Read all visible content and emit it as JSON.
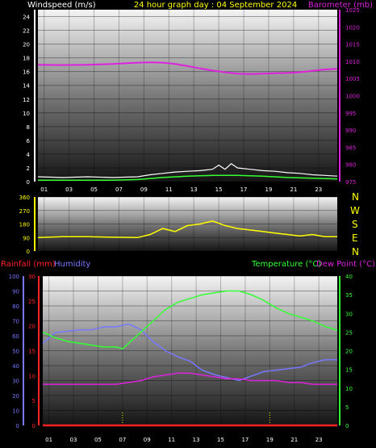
{
  "header": {
    "windspeed_label": "Windspeed (m/s)",
    "title": "24 hour graph day : 04 September 2024",
    "barometer_label": "Barometer (mb)"
  },
  "lower_header": {
    "rainfall_label": "Rainfall (mm)",
    "humidity_label": "Humidity",
    "temperature_label": "Temperature (°C)",
    "dewpoint_label": "Dew Point (°C)"
  },
  "compass": [
    "N",
    "W",
    "S",
    "E",
    "N"
  ],
  "colors": {
    "windspeed": "#ffffff",
    "gust": "#ffffff",
    "wind_avg": "#33ff33",
    "barometer": "#dd22dd",
    "direction": "#ffff00",
    "rainfall": "#ff2222",
    "humidity": "#7777ff",
    "temperature": "#33ff33",
    "dewpoint": "#dd22dd",
    "title": "#ffff00"
  },
  "chart_data": [
    {
      "type": "line",
      "panel": "wind-barometer",
      "x_ticks": [
        "01",
        "03",
        "05",
        "07",
        "09",
        "11",
        "13",
        "15",
        "17",
        "19",
        "21",
        "23"
      ],
      "y_left_ticks": [
        "0",
        "2",
        "4",
        "6",
        "8",
        "10",
        "12",
        "14",
        "16",
        "18",
        "20",
        "22",
        "24"
      ],
      "y_right_ticks": [
        "975",
        "980",
        "985",
        "990",
        "995",
        "1000",
        "1005",
        "1010",
        "1015",
        "1020",
        "1025"
      ],
      "y_left_range": [
        0,
        25
      ],
      "y_right_range": [
        975,
        1025
      ],
      "series": [
        {
          "name": "Windspeed (m/s)",
          "axis": "left",
          "x": [
            0,
            2,
            4,
            6,
            8,
            9,
            10,
            11,
            12,
            13,
            14,
            14.5,
            15,
            15.5,
            16,
            17,
            18,
            19,
            20,
            21,
            22,
            23,
            24
          ],
          "values": [
            0.7,
            0.6,
            0.7,
            0.6,
            0.7,
            1.0,
            1.2,
            1.4,
            1.5,
            1.6,
            1.8,
            2.4,
            1.8,
            2.6,
            2.0,
            1.8,
            1.6,
            1.5,
            1.3,
            1.2,
            1.0,
            0.9,
            0.8
          ]
        },
        {
          "name": "Wind average",
          "axis": "left",
          "x": [
            0,
            2,
            4,
            6,
            8,
            10,
            12,
            14,
            16,
            18,
            20,
            22,
            24
          ],
          "values": [
            0.2,
            0.2,
            0.2,
            0.2,
            0.3,
            0.6,
            0.8,
            0.9,
            0.9,
            0.8,
            0.6,
            0.5,
            0.4
          ]
        },
        {
          "name": "Barometer (mb)",
          "axis": "right",
          "x": [
            0,
            2,
            4,
            6,
            8,
            9,
            10,
            11,
            12,
            13,
            14,
            15,
            16,
            17,
            18,
            19,
            20,
            21,
            22,
            23,
            24
          ],
          "values": [
            1009.0,
            1008.9,
            1009.0,
            1009.2,
            1009.6,
            1009.7,
            1009.6,
            1009.2,
            1008.6,
            1007.9,
            1007.3,
            1006.8,
            1006.4,
            1006.3,
            1006.4,
            1006.5,
            1006.6,
            1006.8,
            1007.2,
            1007.6,
            1007.8
          ]
        }
      ]
    },
    {
      "type": "line",
      "panel": "wind-direction",
      "x_ticks": [],
      "y_left_ticks": [
        "0",
        "90",
        "180",
        "270",
        "360"
      ],
      "y_right_ticks": [
        "N",
        "W",
        "S",
        "E",
        "N"
      ],
      "y_left_range": [
        0,
        360
      ],
      "series": [
        {
          "name": "Wind direction",
          "axis": "left",
          "x": [
            0,
            2,
            4,
            6,
            8,
            9,
            10,
            11,
            12,
            13,
            14,
            15,
            16,
            17,
            18,
            19,
            20,
            21,
            22,
            23,
            24
          ],
          "values": [
            90,
            95,
            95,
            92,
            90,
            110,
            150,
            130,
            170,
            180,
            200,
            170,
            150,
            140,
            130,
            120,
            110,
            100,
            110,
            95,
            95
          ]
        }
      ]
    },
    {
      "type": "line",
      "panel": "temperature-humidity",
      "x_ticks": [
        "01",
        "03",
        "05",
        "07",
        "09",
        "11",
        "13",
        "15",
        "17",
        "19",
        "21",
        "23"
      ],
      "y_humidity_ticks": [
        "0",
        "10",
        "20",
        "30",
        "40",
        "50",
        "60",
        "70",
        "80",
        "90",
        "100"
      ],
      "y_rain_ticks": [
        "0",
        "5",
        "10",
        "15",
        "20",
        "25",
        "30"
      ],
      "y_right_ticks": [
        "0",
        "5",
        "10",
        "15",
        "20",
        "25",
        "30",
        "35",
        "40"
      ],
      "y_humidity_range": [
        0,
        100
      ],
      "y_rain_range": [
        0,
        30
      ],
      "y_right_range": [
        0,
        40
      ],
      "series": [
        {
          "name": "Rainfall (mm)",
          "axis": "rain",
          "x": [
            0,
            24
          ],
          "values": [
            0,
            0
          ]
        },
        {
          "name": "Humidity",
          "axis": "humidity",
          "x": [
            0,
            1,
            2,
            3,
            4,
            5,
            6,
            7,
            8,
            9,
            10,
            11,
            12,
            13,
            14,
            15,
            16,
            17,
            18,
            19,
            20,
            21,
            22,
            23,
            24
          ],
          "values": [
            55,
            62,
            63,
            64,
            64,
            66,
            66,
            68,
            64,
            56,
            50,
            46,
            43,
            37,
            34,
            32,
            30,
            33,
            36,
            37,
            38,
            39,
            42,
            44,
            44
          ]
        },
        {
          "name": "Temperature (°C)",
          "axis": "right",
          "x": [
            0,
            1,
            2,
            3,
            4,
            5,
            6,
            6.5,
            7,
            8,
            9,
            10,
            11,
            12,
            13,
            14,
            15,
            16,
            17,
            18,
            19,
            20,
            21,
            22,
            23,
            24
          ],
          "values": [
            25,
            23.5,
            22.5,
            22,
            21.5,
            21,
            21,
            20.5,
            22,
            25,
            28,
            31,
            33,
            34,
            35,
            35.5,
            36,
            36,
            35,
            33.5,
            31.5,
            30,
            29,
            28,
            26.5,
            25.5
          ]
        },
        {
          "name": "Dew Point (°C)",
          "axis": "right",
          "x": [
            0,
            2,
            4,
            6,
            8,
            9,
            10,
            11,
            12,
            13,
            14,
            15,
            16,
            17,
            18,
            19,
            20,
            21,
            22,
            23,
            24
          ],
          "values": [
            11,
            11,
            11,
            11,
            12,
            13,
            13.5,
            14,
            14,
            13.5,
            13,
            12.5,
            12.5,
            12,
            12,
            12,
            11.5,
            11.5,
            11,
            11,
            11
          ]
        }
      ]
    }
  ]
}
